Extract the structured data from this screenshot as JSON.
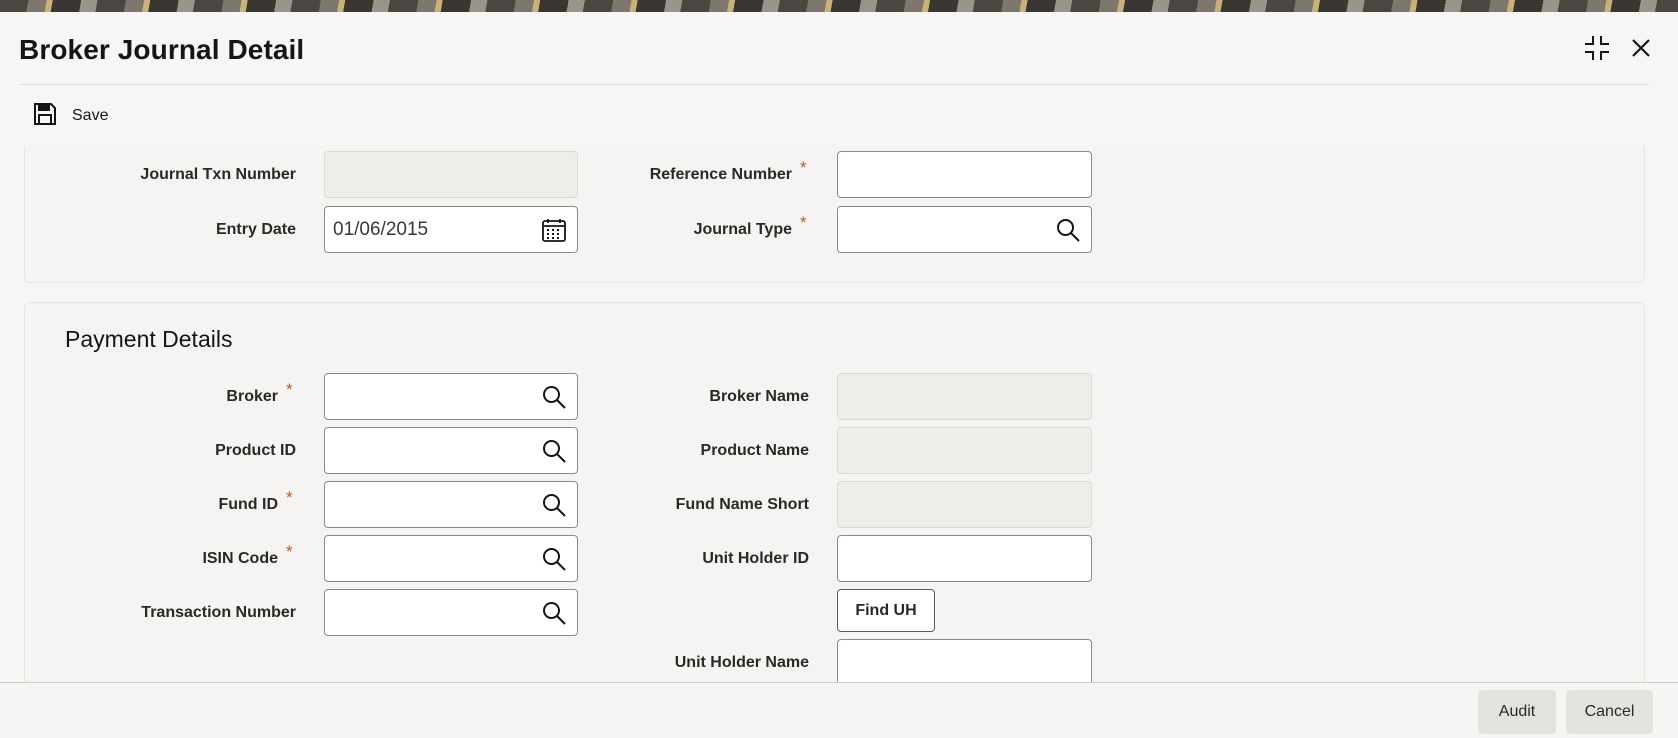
{
  "window": {
    "title": "Broker Journal Detail"
  },
  "toolbar": {
    "save_label": "Save"
  },
  "header": {
    "journal_txn_number_label": "Journal Txn Number",
    "journal_txn_number_value": "",
    "entry_date_label": "Entry Date",
    "entry_date_value": "01/06/2015",
    "reference_number_label": "Reference Number",
    "reference_number_value": "",
    "journal_type_label": "Journal Type",
    "journal_type_value": ""
  },
  "payment": {
    "section_title": "Payment Details",
    "broker_label": "Broker",
    "product_id_label": "Product ID",
    "fund_id_label": "Fund ID",
    "isin_code_label": "ISIN Code",
    "transaction_number_label": "Transaction Number",
    "broker_name_label": "Broker Name",
    "product_name_label": "Product Name",
    "fund_name_short_label": "Fund Name Short",
    "unit_holder_id_label": "Unit Holder ID",
    "find_uh_label": "Find UH",
    "unit_holder_name_label": "Unit Holder Name"
  },
  "required_marker": "*",
  "footer": {
    "audit_label": "Audit",
    "cancel_label": "Cancel"
  },
  "icons": {
    "search": "search-icon",
    "calendar": "calendar-icon",
    "save": "save-icon",
    "collapse": "collapse-icon",
    "close": "close-icon"
  },
  "colors": {
    "required": "#c45522",
    "text": "#161513",
    "border": "#8d8a85"
  }
}
